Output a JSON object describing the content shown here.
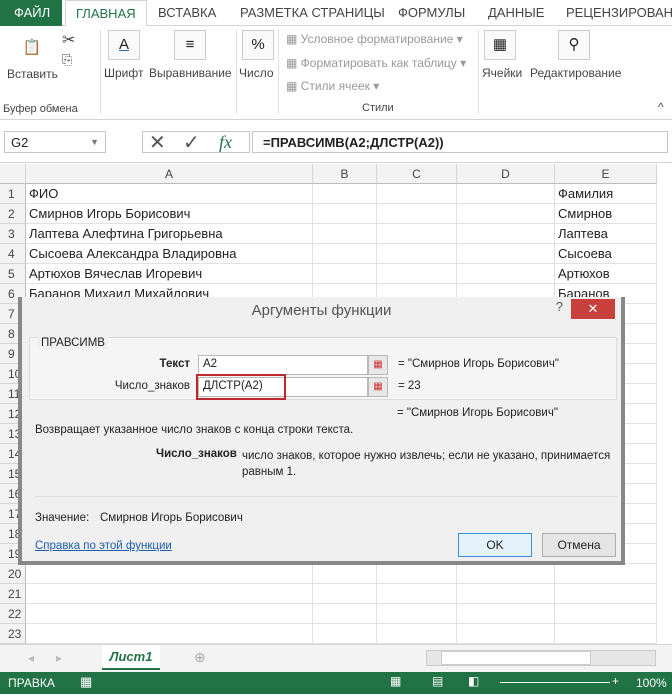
{
  "ribbon_tabs": [
    "ФАЙЛ",
    "ГЛАВНАЯ",
    "ВСТАВКА",
    "РАЗМЕТКА СТРАНИЦЫ",
    "ФОРМУЛЫ",
    "ДАННЫЕ",
    "РЕЦЕНЗИРОВАНИ"
  ],
  "ribbon": {
    "paste": "Вставить",
    "clipboard": "Буфер обмена",
    "font": "Шрифт",
    "align": "Выравнивание",
    "number": "Число",
    "cond": "Условное форматирование",
    "fmt_table": "Форматировать как таблицу",
    "cell_styles": "Стили ячеек",
    "styles": "Стили",
    "cells": "Ячейки",
    "editing": "Редактирование"
  },
  "formula_bar": {
    "name_box": "G2",
    "formula": "=ПРАВСИМВ(A2;ДЛСТР(A2))",
    "fx": "fx"
  },
  "columns": [
    "A",
    "B",
    "C",
    "D",
    "E"
  ],
  "rows": [
    [
      "1",
      "ФИО",
      "Фамилия"
    ],
    [
      "2",
      "Смирнов Игорь Борисович",
      "Смирнов"
    ],
    [
      "3",
      "Лаптева Алефтина Григорьевна",
      "Лаптева"
    ],
    [
      "4",
      "Сысоева Александра Владировна",
      "Сысоева"
    ],
    [
      "5",
      "Артюхов Вячеслав Игоревич",
      "Артюхов"
    ],
    [
      "6",
      "Баранов Михаил Михайлович",
      "Баранов"
    ],
    [
      "7"
    ],
    [
      "8"
    ],
    [
      "9"
    ],
    [
      "10"
    ],
    [
      "11"
    ],
    [
      "12"
    ],
    [
      "13"
    ],
    [
      "14"
    ],
    [
      "15"
    ],
    [
      "16"
    ],
    [
      "17"
    ],
    [
      "18"
    ],
    [
      "19"
    ],
    [
      "20"
    ],
    [
      "21"
    ],
    [
      "22"
    ],
    [
      "23"
    ]
  ],
  "dialog": {
    "title": "Аргументы функции",
    "help": "?",
    "close": "✕",
    "function": "ПРАВСИМВ",
    "arg1_label": "Текст",
    "arg1_value": "A2",
    "arg1_result": "=  \"Смирнов Игорь Борисович\"",
    "arg2_label": "Число_знаков",
    "arg2_value": "ДЛСТР(A2)",
    "arg2_result": "=  23",
    "result": "=  \"Смирнов Игорь Борисович\"",
    "description": "Возвращает указанное число знаков с конца строки текста.",
    "arg_desc_label": "Число_знаков",
    "arg_desc": "число знаков, которое нужно извлечь; если не указано, принимается равным 1.",
    "value_label": "Значение:",
    "value": "Смирнов Игорь Борисович",
    "help_link": "Справка по этой функции",
    "ok": "OK",
    "cancel": "Отмена"
  },
  "sheet_tab": "Лист1",
  "status": {
    "mode": "ПРАВКА",
    "zoom": "100%"
  },
  "colors": {
    "accent": "#217346",
    "highlight": "#c0282d"
  }
}
